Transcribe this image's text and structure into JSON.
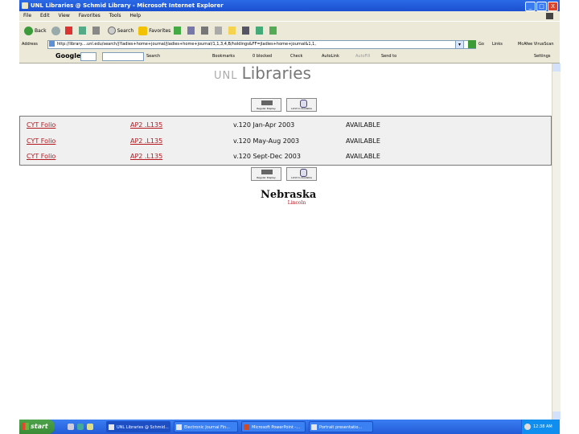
{
  "window": {
    "title": "UNL Libraries @ Schmid Library - Microsoft Internet Explorer",
    "controls": [
      "_",
      "□",
      "X"
    ]
  },
  "menubar": [
    "File",
    "Edit",
    "View",
    "Favorites",
    "Tools",
    "Help"
  ],
  "toolbar": {
    "back_label": "Back",
    "search_label": "Search",
    "favorites_label": "Favorites"
  },
  "addressbar": {
    "label": "Address",
    "url": "http://library....unl.edu/search/j?ladies+home+journal/jladies+home+journal/1,1,3,4,B/holdings&FF=jladies+home+journal&1,1,",
    "go_label": "Go",
    "links_label": "Links",
    "mcafee_label": "McAfee VirusScan"
  },
  "googlebar": {
    "google_label": "Google",
    "go_label": "G",
    "search_label": "Search",
    "bookmarks_label": "Bookmarks",
    "blocked_label": "0 blocked",
    "check_label": "Check",
    "autolink_label": "AutoLink",
    "autofill_label": "AutoFill",
    "sendto_label": "Send to",
    "settings_label": "Settings"
  },
  "page": {
    "logo_prefix": "UNL",
    "logo_main": "Libraries",
    "regular_display_label": "Regular Display",
    "limit_available_label": "Limit to Available",
    "holdings": [
      {
        "location": "CYT Folio",
        "call_number": "AP2 .L135",
        "volume": "v.120 Jan-Apr 2003",
        "status": "AVAILABLE"
      },
      {
        "location": "CYT Folio",
        "call_number": "AP2 .L135",
        "volume": "v.120 May-Aug 2003",
        "status": "AVAILABLE"
      },
      {
        "location": "CYT Folio",
        "call_number": "AP2 .L135",
        "volume": "v.120 Sept-Dec 2003",
        "status": "AVAILABLE"
      }
    ],
    "footer_logo_main": "Nebraska",
    "footer_logo_sub": "Lincoln"
  },
  "taskbar": {
    "start_label": "start",
    "tasks": [
      "UNL Libraries @ Schmid...",
      "Electronic Journal Fin...",
      "Microsoft PowerPoint -...",
      "Portrait presentatio..."
    ],
    "clock": "12:38 AM"
  }
}
